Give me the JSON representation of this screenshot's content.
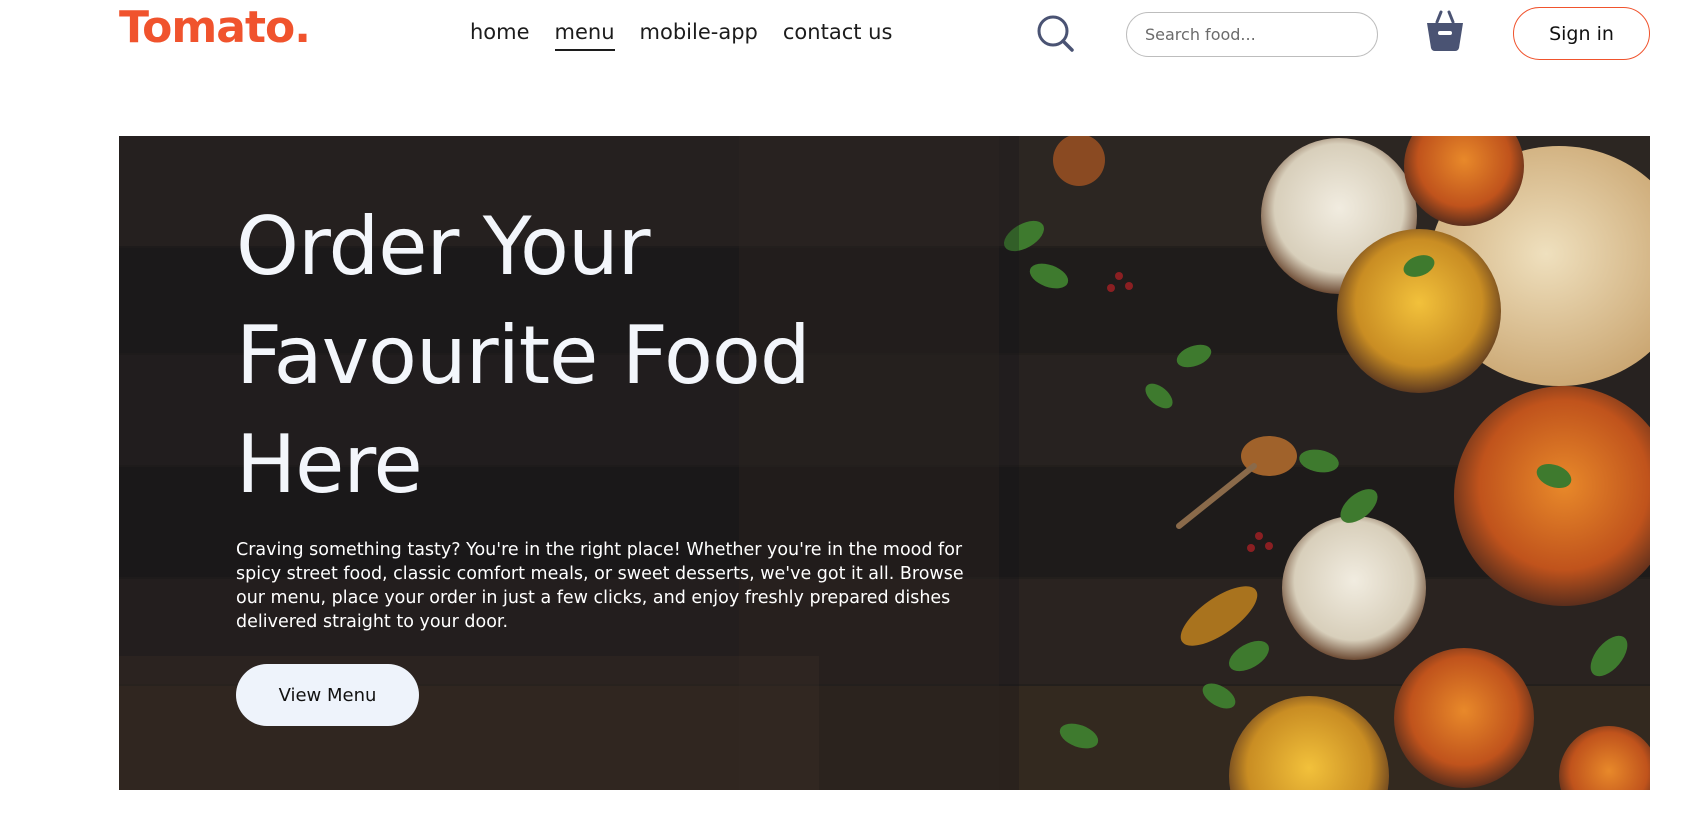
{
  "brand": {
    "logo_text": "Tomato.",
    "accent_color": "#f0532d"
  },
  "nav": {
    "links": [
      {
        "label": "home",
        "active": false
      },
      {
        "label": "menu",
        "active": true
      },
      {
        "label": "mobile-app",
        "active": false
      },
      {
        "label": "contact us",
        "active": false
      }
    ]
  },
  "search": {
    "icon": "search-icon",
    "placeholder": "Search food...",
    "value": ""
  },
  "basket": {
    "icon": "basket-icon"
  },
  "auth": {
    "signin_label": "Sign in"
  },
  "hero": {
    "title": "Order Your Favourite Food Here",
    "description": "Craving something tasty? You're in the right place! Whether you're in the mood for spicy street food, classic comfort meals, or sweet desserts, we've got it all. Browse our menu, place your order in just a few clicks, and enjoy freshly prepared dishes delivered straight to your door.",
    "cta_label": "View Menu"
  }
}
